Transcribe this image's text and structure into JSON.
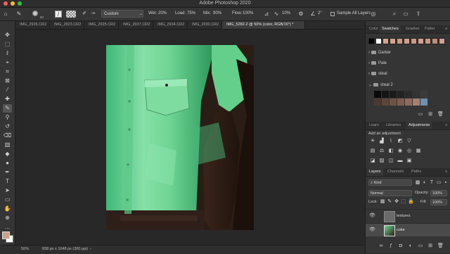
{
  "app": {
    "title": "Adobe Photoshop 2020"
  },
  "options_bar": {
    "brush_size": "60",
    "preset": "Custom",
    "wet_label": "Wet:",
    "wet_value": "20%",
    "load_label": "Load:",
    "load_value": "75%",
    "mix_label": "Mix:",
    "mix_value": "90%",
    "flow_label": "Flow:",
    "flow_value": "100%",
    "smoothing_value": "10%",
    "angle_value": "2°",
    "sample_all_layers_label": "Sample All Layers"
  },
  "document_tabs": [
    {
      "label": "IMG_2926.CR2",
      "active": false
    },
    {
      "label": "IMG_2923.CR2",
      "active": false
    },
    {
      "label": "IMG_2925.CR2",
      "active": false
    },
    {
      "label": "IMG_2937.CR2",
      "active": false
    },
    {
      "label": "IMG_2934.CR2",
      "active": false
    },
    {
      "label": "IMG_2930.CR2",
      "active": false
    },
    {
      "label": "IMG_5282-2 @ 50% (color, RGB/16*) *",
      "active": true
    }
  ],
  "status_bar": {
    "zoom": "50%",
    "doc_info": "838 px x 1048 px (300 ppi)"
  },
  "swatches_panel": {
    "tabs": [
      "Color",
      "Swatches",
      "Gradien",
      "Patter"
    ],
    "active_tab": "Swatches",
    "recent_colors": [
      "#000000",
      "#ffffff",
      "#d6a38e",
      "#d6a38e",
      "#cc9a87",
      "#d3a08c",
      "#c9988a",
      "#d2a08e",
      "#c79684",
      "#bf8e7d",
      "#d1a190"
    ],
    "groups": [
      {
        "name": "Darker",
        "expanded": false
      },
      {
        "name": "Pale",
        "expanded": false
      },
      {
        "name": "steal",
        "expanded": false
      },
      {
        "name": "steal 2",
        "expanded": true
      }
    ],
    "steal2_colors": [
      "#0b0b0b",
      "#141414",
      "#1a1a1a",
      "#222222",
      "#2a2a2a",
      "#333333",
      "#3b3b3b",
      "#4a3a33",
      "#5c463c",
      "#6e5246",
      "#7d5d4f",
      "#8f6b5b",
      "#a5806f",
      "#6f8fb0"
    ]
  },
  "adjustments_panel": {
    "tabs": [
      "Learn",
      "Libraries",
      "Adjustments"
    ],
    "active_tab": "Adjustments",
    "add_label": "Add an adjustment"
  },
  "layers_panel": {
    "tabs": [
      "Layers",
      "Channels",
      "Paths"
    ],
    "active_tab": "Layers",
    "filter_kind": "Kind",
    "blend_mode": "Normal",
    "opacity_label": "Opacity:",
    "opacity_value": "100%",
    "lock_label": "Lock:",
    "fill_label": "Fill:",
    "fill_value": "100%",
    "layers": [
      {
        "name": "textures",
        "visible": true,
        "selected": false
      },
      {
        "name": "color",
        "visible": true,
        "selected": true
      }
    ]
  },
  "colors": {
    "foreground": "#c9a08c",
    "background": "#ffffff",
    "accent": "#3c3c3c"
  }
}
